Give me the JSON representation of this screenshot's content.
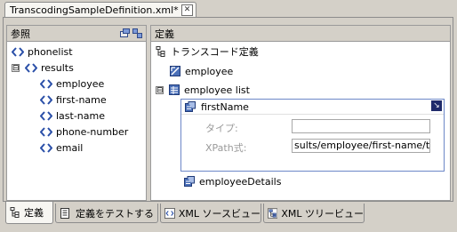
{
  "editor": {
    "tab_title": "TranscodingSampleDefinition.xml*"
  },
  "references": {
    "header": "参照",
    "items": [
      {
        "label": "phonelist"
      },
      {
        "label": "results",
        "expander": "⊟"
      },
      {
        "label": "employee"
      },
      {
        "label": "first-name"
      },
      {
        "label": "last-name"
      },
      {
        "label": "phone-number"
      },
      {
        "label": "email"
      }
    ]
  },
  "definition": {
    "header": "定義",
    "root": "トランスコード定義",
    "employee": "employee",
    "employee_list": "employee list",
    "employee_list_expander": "⊟",
    "first_name": "firstName",
    "type_label": "タイプ:",
    "type_value": "",
    "xpath_label": "XPath式:",
    "xpath_value": "sults/employee/first-name/text()",
    "employee_details": "employeeDetails"
  },
  "bottom_tabs": [
    {
      "label": "定義"
    },
    {
      "label": "定義をテストする"
    },
    {
      "label": "XML ソースビュー"
    },
    {
      "label": "XML ツリービュー"
    }
  ]
}
